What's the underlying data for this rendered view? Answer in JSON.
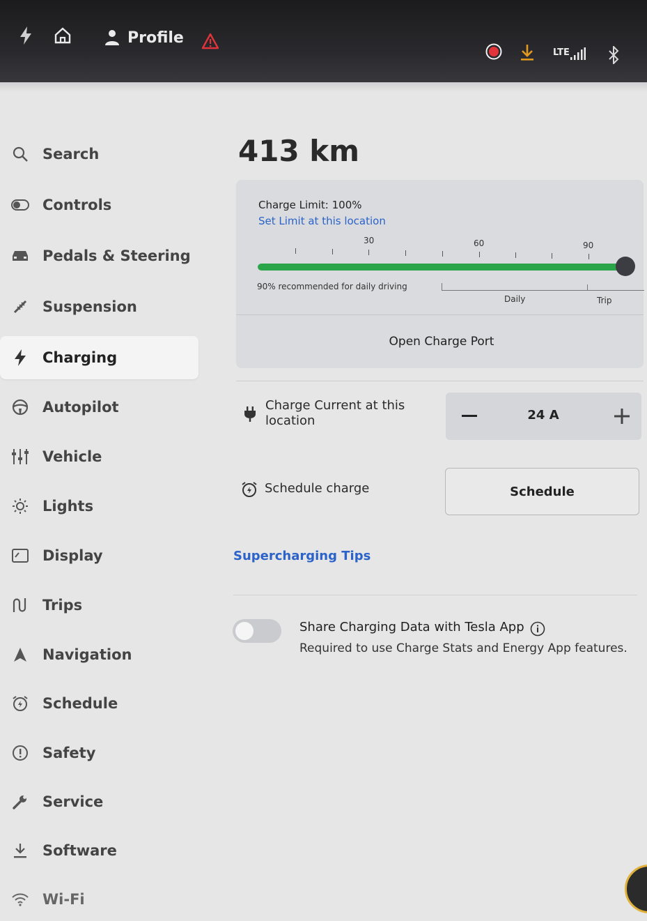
{
  "status_bar": {
    "icons": [
      "bolt-icon",
      "home-icon",
      "person-icon",
      "warning-icon",
      "record-icon",
      "download-icon",
      "signal-icon",
      "bluetooth-icon"
    ],
    "profile_label": "Profile",
    "network_label": "LTE",
    "colors": {
      "warning": "#e0343a",
      "record": "#e0343a",
      "download": "#e09a20"
    }
  },
  "sidebar": {
    "active": "Charging",
    "items": [
      {
        "label": "Search",
        "icon": "search-icon"
      },
      {
        "label": "Controls",
        "icon": "toggle-icon"
      },
      {
        "label": "Pedals & Steering",
        "icon": "car-icon"
      },
      {
        "label": "Suspension",
        "icon": "suspension-icon"
      },
      {
        "label": "Charging",
        "icon": "bolt-icon"
      },
      {
        "label": "Autopilot",
        "icon": "steering-wheel-icon"
      },
      {
        "label": "Vehicle",
        "icon": "sliders-icon"
      },
      {
        "label": "Lights",
        "icon": "light-icon"
      },
      {
        "label": "Display",
        "icon": "display-icon"
      },
      {
        "label": "Trips",
        "icon": "trips-icon"
      },
      {
        "label": "Navigation",
        "icon": "navigation-icon"
      },
      {
        "label": "Schedule",
        "icon": "alarm-icon"
      },
      {
        "label": "Safety",
        "icon": "safety-icon"
      },
      {
        "label": "Service",
        "icon": "wrench-icon"
      },
      {
        "label": "Software",
        "icon": "download-icon"
      },
      {
        "label": "Wi-Fi",
        "icon": "wifi-icon"
      }
    ]
  },
  "main": {
    "range": "413 km",
    "charge_card": {
      "limit_text": "Charge Limit: 100%",
      "limit_value": 100,
      "set_limit_link": "Set Limit at this location",
      "scale_labels": [
        "30",
        "60",
        "90"
      ],
      "recommended_text": "90% recommended for daily driving",
      "daily_label": "Daily",
      "trip_label": "Trip",
      "open_port_button": "Open Charge Port",
      "fill_color": "#2aa54a"
    },
    "charge_current": {
      "label": "Charge Current at this location",
      "value": "24 A",
      "minus": "−",
      "plus": "+"
    },
    "schedule": {
      "label": "Schedule charge",
      "button": "Schedule"
    },
    "tips_link": "Supercharging Tips",
    "share": {
      "title": "Share Charging Data with Tesla App",
      "subtitle": "Required to use Charge Stats and Energy App features.",
      "enabled": false
    },
    "accent_color": "#2b63c9"
  }
}
